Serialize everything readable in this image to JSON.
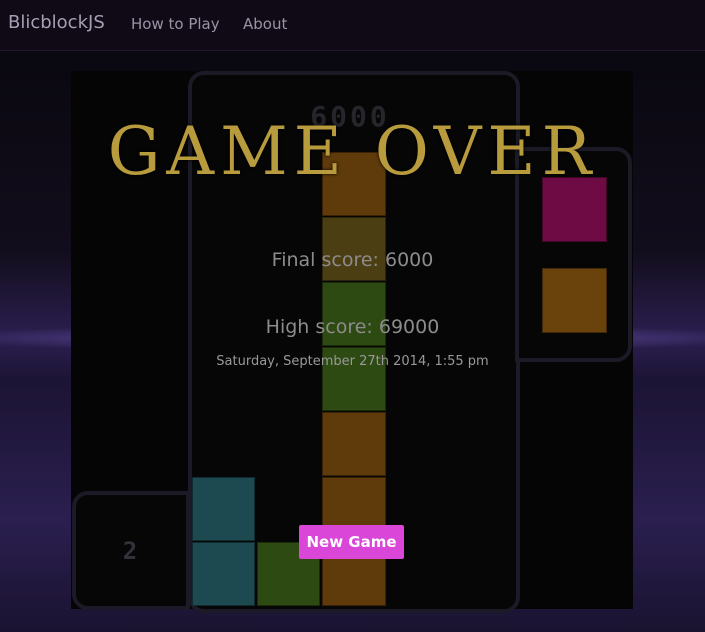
{
  "nav": {
    "brand": "BlicblockJS",
    "links": [
      "How to Play",
      "About"
    ]
  },
  "game": {
    "score_display": "6000",
    "level": "2"
  },
  "game_over": {
    "title": "GAME OVER",
    "final_score": "Final score: 6000",
    "high_score": "High score: 69000",
    "date": "Saturday, September 27th 2014, 1:55 pm",
    "new_game_label": "New Game"
  },
  "colors": {
    "accent": "#d946d8",
    "title": "#b89b3c",
    "block_orange": "#5f3a0a",
    "block_green": "#2c4a12",
    "block_teal": "#1c4a50",
    "block_magenta": "#6e0a44",
    "block_amber": "#6a420c"
  },
  "board": {
    "blocks": [
      {
        "color": "orange"
      },
      {
        "color": "olive"
      },
      {
        "color": "green"
      },
      {
        "color": "green"
      },
      {
        "color": "green"
      },
      {
        "color": "orange"
      },
      {
        "color": "orange"
      },
      {
        "color": "orange"
      },
      {
        "color": "teal"
      },
      {
        "color": "teal"
      },
      {
        "color": "green"
      }
    ]
  },
  "next_queue": [
    {
      "color": "magenta"
    },
    {
      "color": "amber"
    }
  ]
}
